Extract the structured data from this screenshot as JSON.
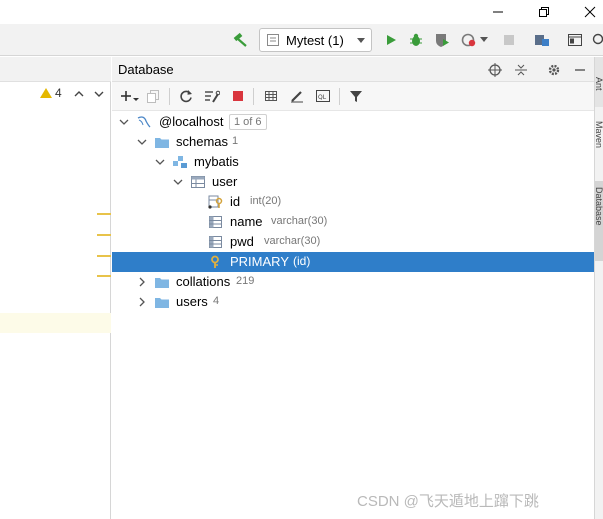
{
  "toolbar": {
    "run_config": "Mytest (1)"
  },
  "editor": {
    "warning_count": "4"
  },
  "database": {
    "title": "Database",
    "tree": {
      "root": {
        "label": "@localhost",
        "badge": "1 of 6"
      },
      "schemas": {
        "label": "schemas",
        "count": "1"
      },
      "mybatis": {
        "label": "mybatis"
      },
      "user": {
        "label": "user"
      },
      "col_id": {
        "label": "id",
        "type": "int(20)"
      },
      "col_name": {
        "label": "name",
        "type": "varchar(30)"
      },
      "col_pwd": {
        "label": "pwd",
        "type": "varchar(30)"
      },
      "primary": {
        "label": "PRIMARY",
        "detail": "(id)"
      },
      "collations": {
        "label": "collations",
        "count": "219"
      },
      "users": {
        "label": "users",
        "count": "4"
      }
    }
  },
  "right_strip": {
    "tabs": [
      "Ant",
      "Maven",
      "Database"
    ]
  },
  "watermark": "CSDN @飞天遁地上蹿下跳",
  "colors": {
    "selection": "#2f7ec9",
    "run_green": "#3a9c3a",
    "stop_red": "#d9363e",
    "folder_blue": "#7fb6e3",
    "key_gold": "#d3a23a",
    "warning_yellow": "#e5b800"
  }
}
